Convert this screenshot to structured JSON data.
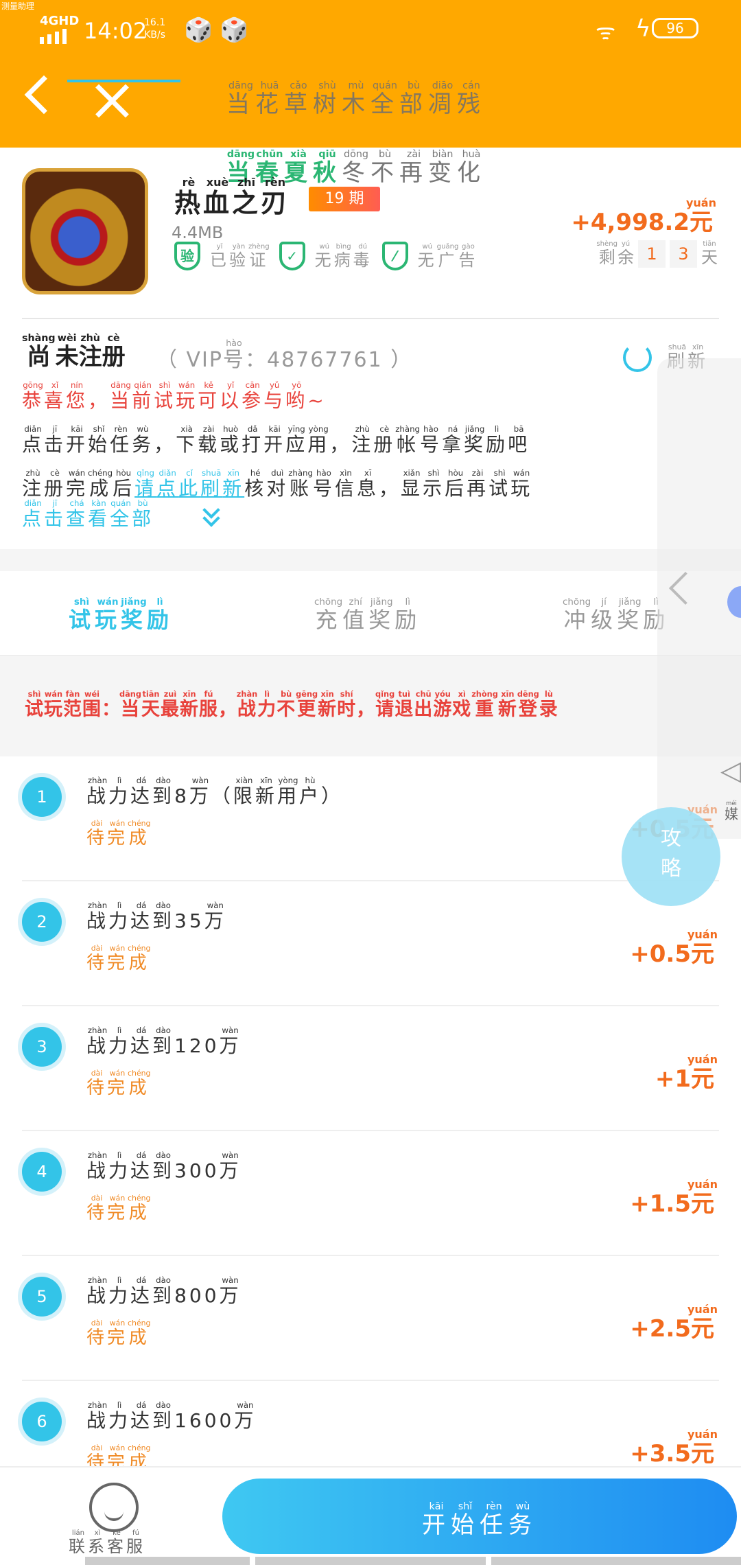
{
  "corner_tag": "测量助理",
  "status_bar": {
    "network": "4GHD",
    "time": "14:02",
    "speed_value": "16.1",
    "speed_unit": "KB/s",
    "battery": "96"
  },
  "nav": {
    "title": [
      [
        "当",
        "dāng"
      ],
      [
        "花",
        "huā"
      ],
      [
        "草",
        "cǎo"
      ],
      [
        "树",
        "shù"
      ],
      [
        "木",
        "mù"
      ],
      [
        "全",
        "quán"
      ],
      [
        "部",
        "bù"
      ],
      [
        "凋",
        "diāo"
      ],
      [
        "残",
        "cán"
      ]
    ]
  },
  "poem_line2": [
    [
      "当",
      "dāng"
    ],
    [
      "春",
      "chūn"
    ],
    [
      "夏",
      "xià"
    ],
    [
      "秋",
      "qiū"
    ],
    [
      "冬",
      "dōng"
    ],
    [
      "不",
      "bù"
    ],
    [
      "再",
      "zài"
    ],
    [
      "变",
      "biàn"
    ],
    [
      "化",
      "huà"
    ]
  ],
  "app": {
    "name": [
      [
        "热",
        "rè"
      ],
      [
        "血",
        "xuè"
      ],
      [
        "之",
        "zhī"
      ],
      [
        "刃",
        "rèn"
      ]
    ],
    "period_label": "19 期",
    "size": "4.4MB",
    "badge_icon_text": "验",
    "badges": [
      [
        [
          "已",
          "yǐ"
        ],
        [
          "验",
          "yàn"
        ],
        [
          "证",
          "zhèng"
        ]
      ],
      [
        [
          "无",
          "wú"
        ],
        [
          "病",
          "bìng"
        ],
        [
          "毒",
          "dú"
        ]
      ],
      [
        [
          "无",
          "wú"
        ],
        [
          "广",
          "guǎng"
        ],
        [
          "告",
          "gào"
        ]
      ]
    ],
    "total_reward": "+4,998.2",
    "currency": [
      "元",
      "yuán"
    ],
    "remaining_label": [
      [
        "剩",
        "shèng"
      ],
      [
        "余",
        "yú"
      ]
    ],
    "remaining_digits": [
      "1",
      "3"
    ],
    "days_label": [
      [
        "天",
        "tiān"
      ]
    ]
  },
  "registration": {
    "title": [
      [
        "尚",
        "shàng"
      ],
      [
        "未",
        "wèi"
      ],
      [
        "注",
        "zhù"
      ],
      [
        "册",
        "cè"
      ]
    ],
    "vip_prefix": "（ VIP",
    "vip_hao": [
      "号",
      "hào"
    ],
    "vip_number": "：48767761 ）",
    "refresh_label": [
      [
        "刷",
        "shuā"
      ],
      [
        "新",
        "xīn"
      ]
    ],
    "congrats": [
      [
        "恭",
        "gōng"
      ],
      [
        "喜",
        "xǐ"
      ],
      [
        "您",
        "nín"
      ],
      [
        "，",
        ""
      ],
      [
        "当",
        "dāng"
      ],
      [
        "前",
        "qián"
      ],
      [
        "试",
        "shì"
      ],
      [
        "玩",
        "wán"
      ],
      [
        "可",
        "kě"
      ],
      [
        "以",
        "yǐ"
      ],
      [
        "参",
        "cān"
      ],
      [
        "与",
        "yǔ"
      ],
      [
        "哟",
        "yō"
      ],
      [
        "~",
        ""
      ]
    ],
    "steps_line1": [
      [
        "点",
        "diǎn"
      ],
      [
        "击",
        "jī"
      ],
      [
        "开",
        "kāi"
      ],
      [
        "始",
        "shǐ"
      ],
      [
        "任",
        "rèn"
      ],
      [
        "务",
        "wù"
      ],
      [
        "，",
        ""
      ],
      [
        "下",
        "xià"
      ],
      [
        "载",
        "zài"
      ],
      [
        "或",
        "huò"
      ],
      [
        "打",
        "dǎ"
      ],
      [
        "开",
        "kāi"
      ],
      [
        "应",
        "yīng"
      ],
      [
        "用",
        "yòng"
      ],
      [
        "，",
        ""
      ],
      [
        "注",
        "zhù"
      ],
      [
        "册",
        "cè"
      ],
      [
        "帐",
        "zhàng"
      ],
      [
        "号",
        "hào"
      ],
      [
        "拿",
        "ná"
      ],
      [
        "奖",
        "jiǎng"
      ],
      [
        "励",
        "lì"
      ],
      [
        "吧",
        "bā"
      ]
    ],
    "steps_line2_a": [
      [
        "注",
        "zhù"
      ],
      [
        "册",
        "cè"
      ],
      [
        "完",
        "wán"
      ],
      [
        "成",
        "chéng"
      ],
      [
        "后",
        "hòu"
      ]
    ],
    "steps_line2_link": [
      [
        "请",
        "qǐng"
      ],
      [
        "点",
        "diǎn"
      ],
      [
        "此",
        "cǐ"
      ],
      [
        "刷",
        "shuā"
      ],
      [
        "新",
        "xīn"
      ]
    ],
    "steps_line2_b": [
      [
        "核",
        "hé"
      ],
      [
        "对",
        "duì"
      ],
      [
        "账",
        "zhàng"
      ],
      [
        "号",
        "hào"
      ],
      [
        "信",
        "xìn"
      ],
      [
        "息",
        "xī"
      ],
      [
        "，",
        ""
      ],
      [
        "显",
        "xiǎn"
      ],
      [
        "示",
        "shì"
      ],
      [
        "后",
        "hòu"
      ],
      [
        "再",
        "zài"
      ],
      [
        "试",
        "shì"
      ],
      [
        "玩",
        "wán"
      ]
    ],
    "view_all": [
      [
        "点",
        "diǎn"
      ],
      [
        "击",
        "jī"
      ],
      [
        "查",
        "chá"
      ],
      [
        "看",
        "kàn"
      ],
      [
        "全",
        "quán"
      ],
      [
        "部",
        "bù"
      ]
    ]
  },
  "tabs": [
    [
      [
        "试",
        "shì"
      ],
      [
        "玩",
        "wán"
      ],
      [
        "奖",
        "jiǎng"
      ],
      [
        "励",
        "lì"
      ]
    ],
    [
      [
        "充",
        "chōng"
      ],
      [
        "值",
        "zhí"
      ],
      [
        "奖",
        "jiǎng"
      ],
      [
        "励",
        "lì"
      ]
    ],
    [
      [
        "冲",
        "chōng"
      ],
      [
        "级",
        "jí"
      ],
      [
        "奖",
        "jiǎng"
      ],
      [
        "励",
        "lì"
      ]
    ]
  ],
  "scope_text": [
    [
      "试",
      "shì"
    ],
    [
      "玩",
      "wán"
    ],
    [
      "范",
      "fàn"
    ],
    [
      "围",
      "wéi"
    ],
    [
      "：",
      ""
    ],
    [
      "当",
      "dāng"
    ],
    [
      "天",
      "tiān"
    ],
    [
      "最",
      "zuì"
    ],
    [
      "新",
      "xīn"
    ],
    [
      "服",
      "fú"
    ],
    [
      "，",
      ""
    ],
    [
      "战",
      "zhàn"
    ],
    [
      "力",
      "lì"
    ],
    [
      "不",
      "bù"
    ],
    [
      "更",
      "gēng"
    ],
    [
      "新",
      "xīn"
    ],
    [
      "时",
      "shí"
    ],
    [
      "，",
      ""
    ],
    [
      "请",
      "qǐng"
    ],
    [
      "退",
      "tuì"
    ],
    [
      "出",
      "chū"
    ],
    [
      "游",
      "yóu"
    ],
    [
      "戏",
      "xì"
    ],
    [
      "重",
      "zhòng"
    ],
    [
      "新",
      "xīn"
    ],
    [
      "登",
      "dēng"
    ],
    [
      "录",
      "lù"
    ]
  ],
  "tasks": [
    {
      "num": "1",
      "title": [
        [
          "战",
          "zhàn"
        ],
        [
          "力",
          "lì"
        ],
        [
          "达",
          "dá"
        ],
        [
          "到",
          "dào"
        ],
        [
          "8",
          ""
        ],
        [
          "万",
          "wàn"
        ],
        [
          "（",
          ""
        ],
        [
          "限",
          "xiàn"
        ],
        [
          "新",
          "xīn"
        ],
        [
          "用",
          "yòng"
        ],
        [
          "户",
          "hù"
        ],
        [
          "）",
          ""
        ]
      ],
      "status": [
        [
          "待",
          "dài"
        ],
        [
          "完",
          "wán"
        ],
        [
          "成",
          "chéng"
        ]
      ],
      "reward": "+0.5"
    },
    {
      "num": "2",
      "title": [
        [
          "战",
          "zhàn"
        ],
        [
          "力",
          "lì"
        ],
        [
          "达",
          "dá"
        ],
        [
          "到",
          "dào"
        ],
        [
          "35",
          ""
        ],
        [
          "万",
          "wàn"
        ]
      ],
      "status": [
        [
          "待",
          "dài"
        ],
        [
          "完",
          "wán"
        ],
        [
          "成",
          "chéng"
        ]
      ],
      "reward": "+0.5"
    },
    {
      "num": "3",
      "title": [
        [
          "战",
          "zhàn"
        ],
        [
          "力",
          "lì"
        ],
        [
          "达",
          "dá"
        ],
        [
          "到",
          "dào"
        ],
        [
          "120",
          ""
        ],
        [
          "万",
          "wàn"
        ]
      ],
      "status": [
        [
          "待",
          "dài"
        ],
        [
          "完",
          "wán"
        ],
        [
          "成",
          "chéng"
        ]
      ],
      "reward": "+1"
    },
    {
      "num": "4",
      "title": [
        [
          "战",
          "zhàn"
        ],
        [
          "力",
          "lì"
        ],
        [
          "达",
          "dá"
        ],
        [
          "到",
          "dào"
        ],
        [
          "300",
          ""
        ],
        [
          "万",
          "wàn"
        ]
      ],
      "status": [
        [
          "待",
          "dài"
        ],
        [
          "完",
          "wán"
        ],
        [
          "成",
          "chéng"
        ]
      ],
      "reward": "+1.5"
    },
    {
      "num": "5",
      "title": [
        [
          "战",
          "zhàn"
        ],
        [
          "力",
          "lì"
        ],
        [
          "达",
          "dá"
        ],
        [
          "到",
          "dào"
        ],
        [
          "800",
          ""
        ],
        [
          "万",
          "wàn"
        ]
      ],
      "status": [
        [
          "待",
          "dài"
        ],
        [
          "完",
          "wán"
        ],
        [
          "成",
          "chéng"
        ]
      ],
      "reward": "+2.5"
    },
    {
      "num": "6",
      "title": [
        [
          "战",
          "zhàn"
        ],
        [
          "力",
          "lì"
        ],
        [
          "达",
          "dá"
        ],
        [
          "到",
          "dào"
        ],
        [
          "1600",
          ""
        ],
        [
          "万",
          "wàn"
        ]
      ],
      "status": [
        [
          "待",
          "dài"
        ],
        [
          "完",
          "wán"
        ],
        [
          "成",
          "chéng"
        ]
      ],
      "reward": "+3.5"
    }
  ],
  "floating": {
    "guide_label": "攻略",
    "media_label": [
      [
        "媒",
        "méi"
      ]
    ]
  },
  "bottom": {
    "service_label": [
      [
        "联",
        "lián"
      ],
      [
        "系",
        "xì"
      ],
      [
        "客",
        "kè"
      ],
      [
        "服",
        "fú"
      ]
    ],
    "start_label": [
      [
        "开",
        "kāi"
      ],
      [
        "始",
        "shǐ"
      ],
      [
        "任",
        "rèn"
      ],
      [
        "务",
        "wù"
      ]
    ]
  }
}
